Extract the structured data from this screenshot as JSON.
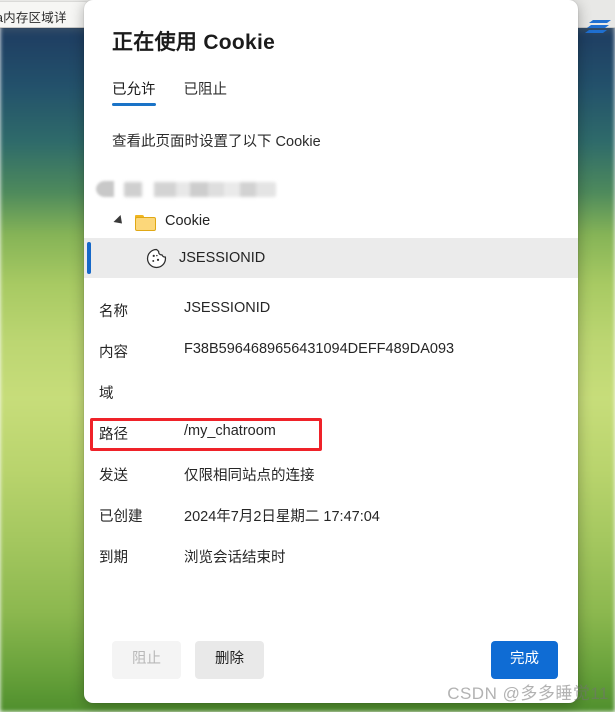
{
  "browser": {
    "tab_title": "a内存区域详",
    "brand_icon": "blue-stripes-logo-icon"
  },
  "dialog": {
    "title": "正在使用 Cookie",
    "tabs": [
      {
        "label": "已允许",
        "active": true
      },
      {
        "label": "已阻止",
        "active": false
      }
    ],
    "subtitle": "查看此页面时设置了以下 Cookie",
    "tree": {
      "origin": {
        "label": "",
        "redacted": true,
        "icon": "globe-icon"
      },
      "folder": {
        "label": "Cookie",
        "icon": "folder-icon",
        "expanded": true
      },
      "cookie": {
        "label": "JSESSIONID",
        "icon": "cookie-icon",
        "selected": true
      }
    },
    "details": [
      {
        "label": "名称",
        "value": "JSESSIONID",
        "redacted": false,
        "highlighted": false
      },
      {
        "label": "内容",
        "value": "F38B5964689656431094DEFF489DA093",
        "redacted": false,
        "highlighted": false
      },
      {
        "label": "域",
        "value": "",
        "redacted": true,
        "highlighted": false
      },
      {
        "label": "路径",
        "value": "/my_chatroom",
        "redacted": false,
        "highlighted": true
      },
      {
        "label": "发送",
        "value": "仅限相同站点的连接",
        "redacted": false,
        "highlighted": false
      },
      {
        "label": "已创建",
        "value": "2024年7月2日星期二 17:47:04",
        "redacted": false,
        "highlighted": false
      },
      {
        "label": "到期",
        "value": "浏览会话结束时",
        "redacted": false,
        "highlighted": false
      }
    ],
    "footer": {
      "block_label": "阻止",
      "block_disabled": true,
      "delete_label": "删除",
      "done_label": "完成"
    }
  },
  "watermark": "CSDN @多多睡觉11",
  "colors": {
    "accent_blue": "#1a73c7",
    "primary_button": "#0f6cd4",
    "highlight_red": "#ef2229",
    "selection_bar": "#1668c8",
    "selection_bg": "#ebebeb",
    "folder_yellow": "#fcd77a"
  }
}
